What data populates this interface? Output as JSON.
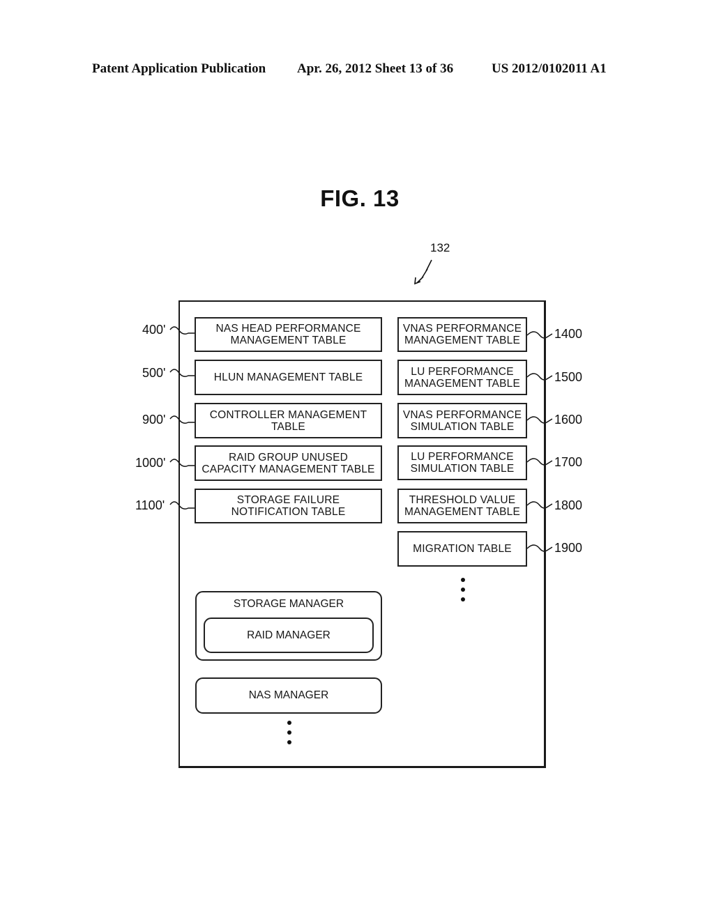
{
  "header": {
    "left": "Patent Application Publication",
    "center": "Apr. 26, 2012  Sheet 13 of 36",
    "right": "US 2012/0102011 A1"
  },
  "figure": {
    "title": "FIG. 13",
    "container_ref": "132"
  },
  "left_tables": [
    {
      "ref": "400'",
      "label": "NAS HEAD PERFORMANCE\nMANAGEMENT TABLE"
    },
    {
      "ref": "500'",
      "label": "HLUN MANAGEMENT TABLE"
    },
    {
      "ref": "900'",
      "label": "CONTROLLER MANAGEMENT\nTABLE"
    },
    {
      "ref": "1000'",
      "label": "RAID GROUP UNUSED\nCAPACITY MANAGEMENT TABLE"
    },
    {
      "ref": "1100'",
      "label": "STORAGE FAILURE\nNOTIFICATION TABLE"
    }
  ],
  "right_tables": [
    {
      "ref": "1400",
      "label": "VNAS PERFORMANCE\nMANAGEMENT TABLE"
    },
    {
      "ref": "1500",
      "label": "LU PERFORMANCE\nMANAGEMENT TABLE"
    },
    {
      "ref": "1600",
      "label": "VNAS PERFORMANCE\nSIMULATION TABLE"
    },
    {
      "ref": "1700",
      "label": "LU PERFORMANCE\nSIMULATION TABLE"
    },
    {
      "ref": "1800",
      "label": "THRESHOLD VALUE\nMANAGEMENT TABLE"
    },
    {
      "ref": "1900",
      "label": "MIGRATION TABLE"
    }
  ],
  "programs": {
    "storage_manager": "STORAGE MANAGER",
    "raid_manager": "RAID MANAGER",
    "nas_manager": "NAS MANAGER"
  }
}
